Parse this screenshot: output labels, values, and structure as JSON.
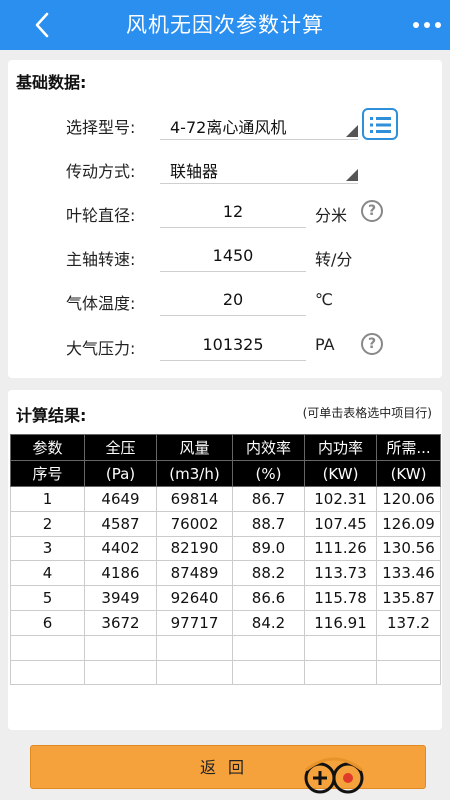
{
  "header": {
    "title": "风机无因次参数计算"
  },
  "basic": {
    "section_title": "基础数据:",
    "model_label": "选择型号:",
    "model_value": "4-72离心通风机",
    "drive_label": "传动方式:",
    "drive_value": "联轴器",
    "impeller_label": "叶轮直径:",
    "impeller_value": "12",
    "impeller_unit": "分米",
    "speed_label": "主轴转速:",
    "speed_value": "1450",
    "speed_unit": "转/分",
    "temp_label": "气体温度:",
    "temp_value": "20",
    "temp_unit": "℃",
    "pressure_label": "大气压力:",
    "pressure_value": "101325",
    "pressure_unit": "PA",
    "help_glyph": "?"
  },
  "results": {
    "section_title": "计算结果:",
    "hint": "(可单击表格选中项目行)",
    "header_row1": [
      "参数",
      "全压",
      "风量",
      "内效率",
      "内功率",
      "所需..."
    ],
    "header_row2": [
      "序号",
      "(Pa)",
      "(m3/h)",
      "(%)",
      "(KW)",
      "(KW)"
    ],
    "rows": [
      [
        "1",
        "4649",
        "69814",
        "86.7",
        "102.31",
        "120.06"
      ],
      [
        "2",
        "4587",
        "76002",
        "88.7",
        "107.45",
        "126.09"
      ],
      [
        "3",
        "4402",
        "82190",
        "89.0",
        "111.26",
        "130.56"
      ],
      [
        "4",
        "4186",
        "87489",
        "88.2",
        "113.73",
        "133.46"
      ],
      [
        "5",
        "3949",
        "92640",
        "86.6",
        "115.78",
        "135.87"
      ],
      [
        "6",
        "3672",
        "97717",
        "84.2",
        "116.91",
        "137.2"
      ],
      [
        "",
        "",
        "",
        "",
        "",
        ""
      ],
      [
        "",
        "",
        "",
        "",
        "",
        ""
      ]
    ]
  },
  "footer": {
    "return_label": "返回"
  },
  "icons": {
    "back": "chevron-left-icon",
    "more": "more-dots-icon",
    "list": "list-icon",
    "help": "help-circle-icon"
  },
  "colors": {
    "header": "#2b8ff0",
    "button": "#f6a23c",
    "accent": "#2f8fd8"
  }
}
